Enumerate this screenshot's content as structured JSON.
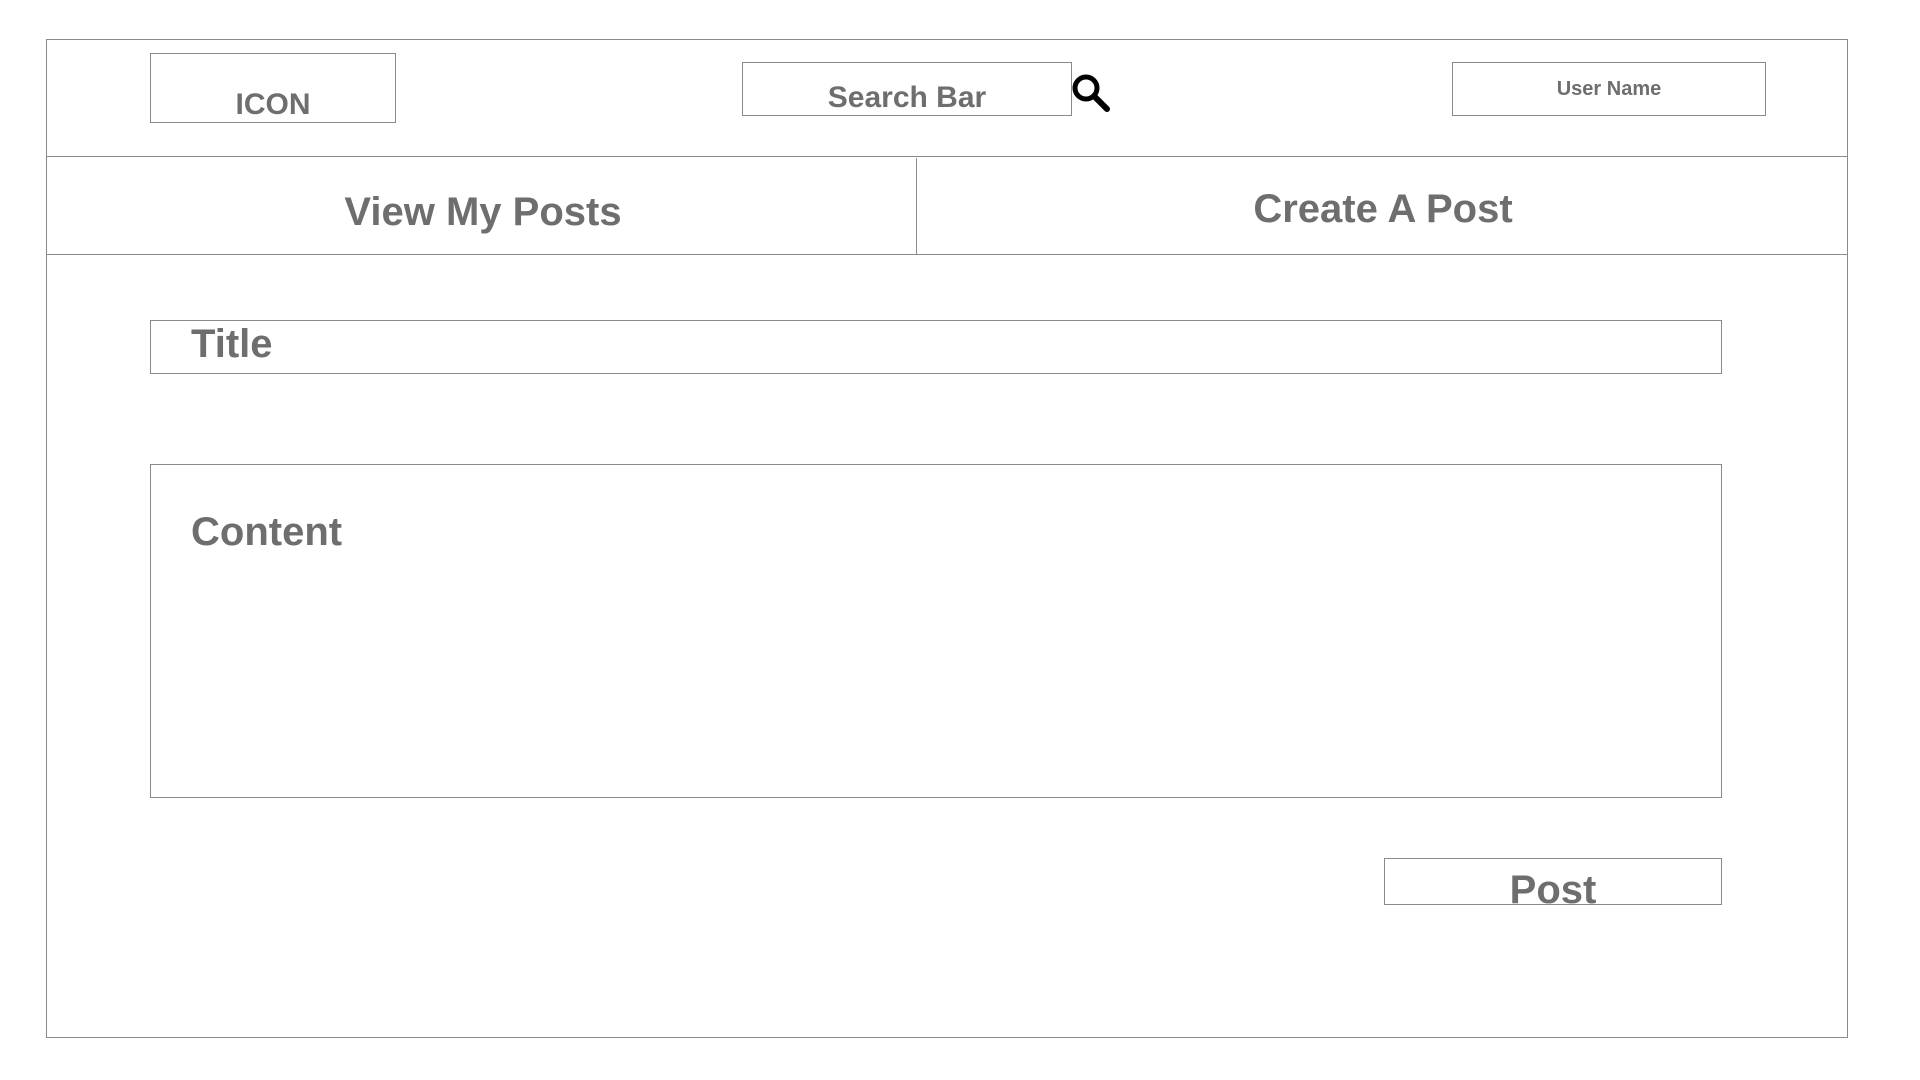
{
  "header": {
    "logo_label": "ICON",
    "search_placeholder": "Search Bar",
    "search_icon": "search-icon",
    "user_name": "User Name"
  },
  "nav": {
    "tabs": [
      {
        "label": "View My Posts"
      },
      {
        "label": "Create A Post"
      }
    ]
  },
  "form": {
    "title_placeholder": "Title",
    "content_placeholder": "Content",
    "post_button_label": "Post"
  },
  "colors": {
    "border": "#8a8a8a",
    "text": "#6e6e6e",
    "icon": "#000000"
  }
}
